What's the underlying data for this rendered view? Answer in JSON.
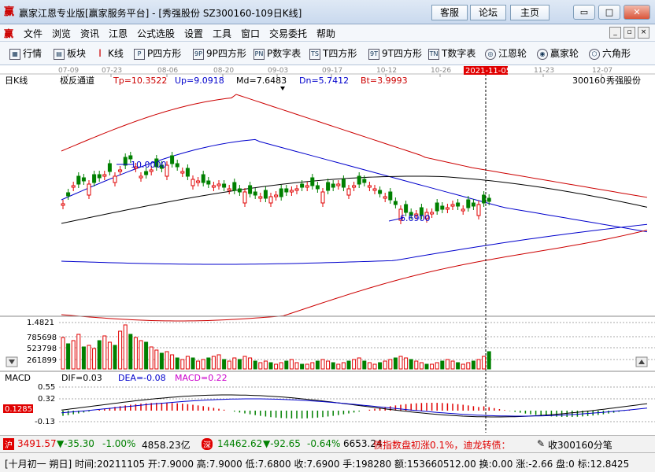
{
  "window": {
    "title": "赢家江恩专业版[赢家服务平台] - [秀强股份  SZ300160-109日K线]",
    "buttons": [
      "客服",
      "论坛",
      "主页"
    ],
    "controls": [
      "▭",
      "□",
      "✕"
    ]
  },
  "menu": [
    "文件",
    "浏览",
    "资讯",
    "江恩",
    "公式选股",
    "设置",
    "工具",
    "窗口",
    "交易委托",
    "帮助"
  ],
  "menu_controls": [
    "_",
    "▫",
    "×"
  ],
  "toolbar": [
    {
      "label": "行情",
      "icon": "quote-grid-icon"
    },
    {
      "label": "板块",
      "icon": "sector-icon"
    },
    {
      "label": "K线",
      "icon": "candlestick-icon"
    },
    {
      "label": "P四方形",
      "icon": "P",
      "icon_name": "p-square-icon"
    },
    {
      "label": "9P四方形",
      "icon": "9P",
      "icon_name": "9p-square-icon"
    },
    {
      "label": "P数字表",
      "icon": "PN",
      "icon_name": "p-number-table-icon"
    },
    {
      "label": "T四方形",
      "icon": "TS",
      "icon_name": "t-square-icon"
    },
    {
      "label": "9T四方形",
      "icon": "9T",
      "icon_name": "9t-square-icon"
    },
    {
      "label": "T数字表",
      "icon": "TN",
      "icon_name": "t-number-table-icon"
    },
    {
      "label": "江恩轮",
      "icon": "gann-wheel-icon"
    },
    {
      "label": "赢家轮",
      "icon": "winner-wheel-icon"
    },
    {
      "label": "六角形",
      "icon": "hexagon-icon"
    }
  ],
  "chart": {
    "period_label": "日K线",
    "date_ticks": [
      "07-09",
      "07-23",
      "08-06",
      "08-20",
      "09-03",
      "09-17",
      "10-12",
      "10-26",
      "2021-11-05",
      "11-23",
      "12-07"
    ],
    "indicator_name": "极反通道",
    "params": {
      "tp": "Tp=10.3522",
      "up": "Up=9.0918",
      "md": "Md=7.6483",
      "dn": "Dn=5.7412",
      "bt": "Bt=3.9993"
    },
    "stock_code": "300160",
    "stock_name": "秀强股份",
    "high_marker": "10.0000",
    "low_marker": "6.6900",
    "volume_ticks": [
      "1.4821",
      "785698",
      "523798",
      "261899"
    ],
    "macd_label": "MACD",
    "macd_dif": "DIF=0.03",
    "macd_dea": "DEA=-0.08",
    "macd_val": "MACD=0.22",
    "macd_ticks": [
      "0.55",
      "0.32",
      "-0.13"
    ],
    "macd_current": "0.1285",
    "colors": {
      "up": "#e00000",
      "down": "#008000",
      "band_outer": "#cc0000",
      "band_inner": "#0000cc"
    }
  },
  "status": {
    "sh_icon": "沪",
    "sh_index": "3491.57",
    "sh_change": "▼-35.30",
    "sh_pct": "-1.00%",
    "sh_amount": "4858.23亿",
    "sz_icon": "深",
    "sz_index": "14462.62",
    "sz_change": "▼-92.65",
    "sz_pct": "-0.64%",
    "sz_amount": "6653.24",
    "news": "债指数盘初涨0.1%，迪龙转债：",
    "pen_label": "收300160分笔"
  },
  "info": "[十月初一  朔日] 时间:20211105 开:7.9000 高:7.9000 低:7.6800 收:7.6900 手:198280 额:153660512.00 换:0.00 涨:-2.66 盘:0 标:12.8425"
}
